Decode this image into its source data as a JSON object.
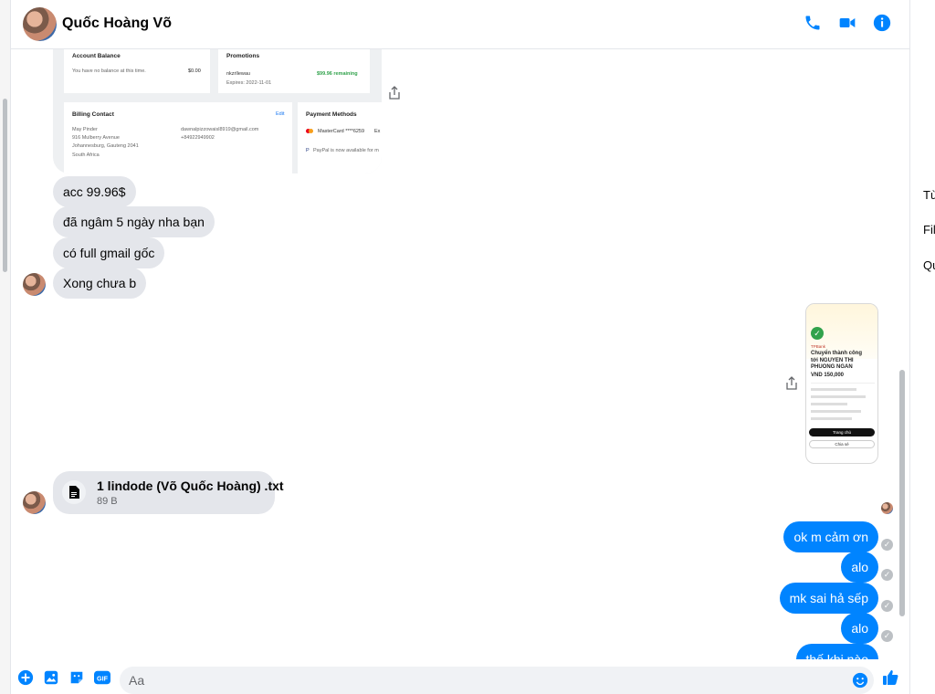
{
  "header": {
    "title": "Quốc Hoàng Võ"
  },
  "billing_screenshot": {
    "account_balance": {
      "heading": "Account Balance",
      "text": "You have no balance at this time.",
      "amount": "$0.00"
    },
    "promotions": {
      "heading": "Promotions",
      "code": "nkzrllewau",
      "remaining": "$99.96 remaining",
      "expires": "Expires: 2022-11-01"
    },
    "billing_contact": {
      "heading": "Billing Contact",
      "edit": "Edit",
      "lines": [
        "May Pinder",
        "916 Mulberry Avenue",
        "Johannesburg, Gauteng 2041",
        "South Africa"
      ],
      "email": "dawnalpizzowaisl8919@gmail.com",
      "phone": "+84922949902"
    },
    "payment_methods": {
      "heading": "Payment Methods",
      "card": "MasterCard ****6259",
      "card_suffix": "Ex",
      "paypal": "PayPal is now available for m"
    }
  },
  "messages_in": [
    {
      "text": "acc 99.96$"
    },
    {
      "text": "đã ngâm 5 ngày nha bạn"
    },
    {
      "text": "có full gmail gốc"
    },
    {
      "text": "Xong chưa b"
    }
  ],
  "receipt": {
    "brand": "TPBank",
    "title": "Chuyển thành công",
    "recipient": "tới NGUYEN THI PHUONG NGAN",
    "amount": "VND 150,000",
    "button_primary": "Trang chủ",
    "button_secondary": "Chia sẻ"
  },
  "file": {
    "name": "1 lindode (Võ Quốc Hoàng) .txt",
    "size": "89 B"
  },
  "messages_out": [
    {
      "text": "ok m cảm ơn"
    },
    {
      "text": "alo"
    },
    {
      "text": "mk sai hả sếp"
    },
    {
      "text": "alo"
    },
    {
      "text": "thế khi nào"
    }
  ],
  "composer": {
    "placeholder": "Aa"
  },
  "right_panel": {
    "items": [
      "Tùy chỉnh đoạn chat",
      "File phương tiện",
      "Quyền riêng tư"
    ]
  },
  "colors": {
    "accent": "#0084ff",
    "incoming_bubble": "#e4e6eb",
    "promo_green": "#31a24c"
  }
}
